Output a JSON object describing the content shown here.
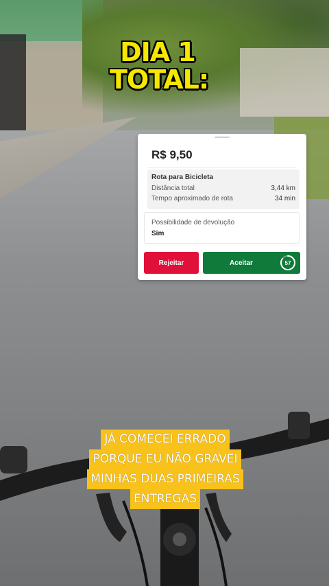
{
  "overlay": {
    "title_line1": "DIA 1",
    "title_line2": "TOTAL:"
  },
  "order_card": {
    "price": "R$ 9,50",
    "route_title": "Rota para Bicicleta",
    "distance_label": "Distância total",
    "distance_value": "3,44 km",
    "time_label": "Tempo aproximado de rota",
    "time_value": "34 min",
    "return_label": "Possibilidade de devolução",
    "return_value": "Sim",
    "reject_label": "Rejeitar",
    "accept_label": "Aceitar",
    "countdown": "57",
    "countdown_progress": 0.85,
    "colors": {
      "reject": "#e0103a",
      "accept": "#0f7a3a"
    }
  },
  "caption": {
    "lines": [
      "JÁ COMECEI ERRADO",
      "PORQUE EU NÃO GRAVEI",
      "MINHAS DUAS PRIMEIRAS",
      "ENTREGAS"
    ],
    "background": "#f9c21a"
  }
}
